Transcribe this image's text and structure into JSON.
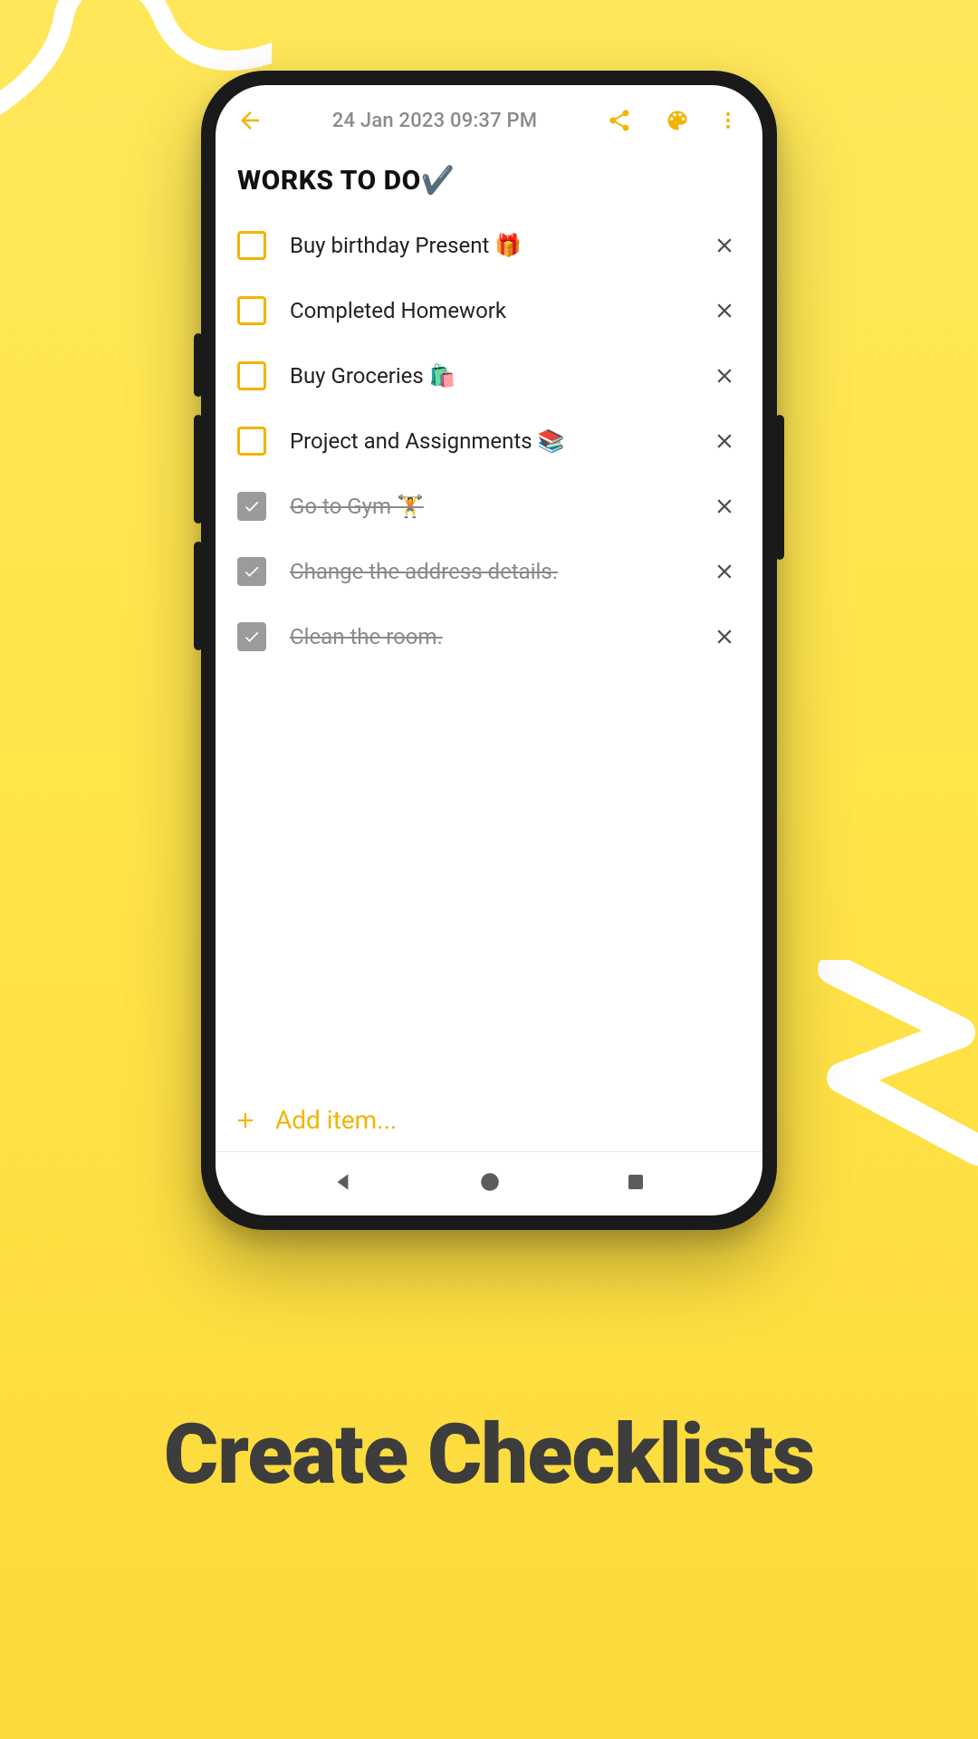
{
  "promo": {
    "headline": "Create Checklists"
  },
  "colors": {
    "accent": "#f2b400",
    "muted": "#8a8a8a",
    "headline": "#3d3d3d"
  },
  "header": {
    "timestamp": "24 Jan 2023 09:37 PM",
    "icons": {
      "back": "back-arrow",
      "share": "share",
      "palette": "palette",
      "more": "more-vert"
    }
  },
  "note": {
    "title": "WORKS TO DO✔️"
  },
  "checklist": {
    "items": [
      {
        "text": "Buy birthday Present 🎁",
        "checked": false
      },
      {
        "text": "Completed Homework",
        "checked": false
      },
      {
        "text": "Buy Groceries 🛍️",
        "checked": false
      },
      {
        "text": "Project and Assignments 📚",
        "checked": false
      },
      {
        "text": "Go to Gym 🏋️",
        "checked": true
      },
      {
        "text": "Change the address details.",
        "checked": true
      },
      {
        "text": "Clean the room.",
        "checked": true
      }
    ]
  },
  "addItem": {
    "label": "Add item..."
  }
}
